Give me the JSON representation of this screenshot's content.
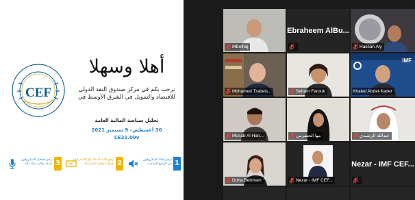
{
  "slide": {
    "welcome": "أهلا وسهلا",
    "intro_line1": "نرحب بكم في مركز صندوق النقد الدولي",
    "intro_line2": "للاقتصاد والتمويل في الشرق الأوسط في",
    "intro_line3": "",
    "course_title": "تحليل سياسة المالية العامة",
    "dates": "30 أغسطس– 9 سبتمبر 2021",
    "course_code": "CE21.09v",
    "instructions": [
      {
        "number": "1",
        "line1": "نرجو إبقاء الميكروفون",
        "line2": "في الوضع الصامت",
        "color": "#1d7fd2",
        "icon": "mute-speaker-icon"
      },
      {
        "number": "2",
        "line1": "نرجو كتابة اسمك (أو الاسم الذي",
        "line2": "تفضله) بحقل المشاركة",
        "color": "#f1b400",
        "icon": "rename-icon"
      },
      {
        "number": "3",
        "line1": "نرجو تشغيل الميكروفون",
        "line2": "عندما يطلب منك ذلك",
        "color": "#f1b400",
        "icon": "microphone-icon"
      }
    ]
  },
  "participants": [
    {
      "name": "",
      "label": "MBelhaj",
      "muted": true
    },
    {
      "name": "Ebraheem AlBu...",
      "label": "",
      "muted": true
    },
    {
      "name": "",
      "label": "Hassan Aly",
      "muted": true
    },
    {
      "name": "",
      "label": "Mohamed Trabels...",
      "muted": true
    },
    {
      "name": "",
      "label": "Seham Farouk",
      "muted": true
    },
    {
      "name": "",
      "label": "Khaled Abdel-Kader",
      "muted": false,
      "active": true,
      "badge": "IMF"
    },
    {
      "name": "",
      "label": "Musab Al Han...",
      "muted": true
    },
    {
      "name": "",
      "label": "مها الحضرمي",
      "muted": true
    },
    {
      "name": "",
      "label": "عبدالله الرشيدي",
      "muted": true
    },
    {
      "name": "",
      "label": "Doha Belimam",
      "muted": true
    },
    {
      "name": "",
      "label": "Nezar - IMF CEF...",
      "muted": true
    },
    {
      "name": "Nezar - IMF CEF...",
      "label": "",
      "muted": true
    },
    {
      "name": "",
      "label": "",
      "muted": false
    },
    {
      "name": "",
      "label": "",
      "muted": false
    },
    {
      "name": "",
      "label": "",
      "muted": false
    }
  ],
  "colors": {
    "accent_active": "#c7e36a",
    "muted_red": "#e0443a",
    "slide_blue": "#1b7fd6"
  }
}
